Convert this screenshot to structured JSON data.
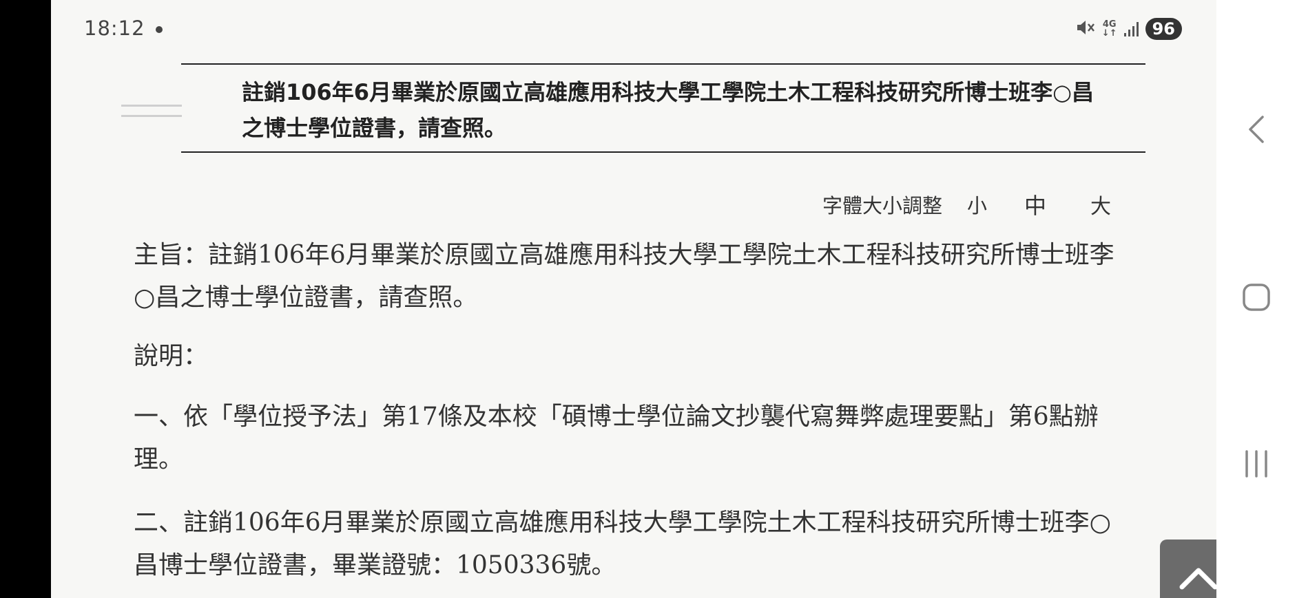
{
  "status_bar": {
    "time": "18:12",
    "network": "4G",
    "battery": "96",
    "icons": [
      "notification-dot-icon",
      "mute-icon",
      "network-4g-icon",
      "signal-icon",
      "battery-icon"
    ]
  },
  "document": {
    "title": "註銷106年6月畢業於原國立高雄應用科技大學工學院土木工程科技研究所博士班李○昌之博士學位證書，請查照。",
    "font_size_control": {
      "label": "字體大小調整",
      "small": "小",
      "medium": "中",
      "large": "大"
    },
    "subject": "主旨：註銷106年6月畢業於原國立高雄應用科技大學工學院土木工程科技研究所博士班李○昌之博士學位證書，請查照。",
    "description_label": "說明：",
    "items": [
      "一、依「學位授予法」第17條及本校「碩博士學位論文抄襲代寫舞弊處理要點」第6點辦理。",
      "二、註銷106年6月畢業於原國立高雄應用科技大學工學院土木工程科技研究所博士班李○昌博士學位證書，畢業證號：1050336號。"
    ]
  },
  "back_to_top": {
    "icon": "chevron-up-icon"
  },
  "nav_bar": {
    "icons": [
      "back-icon",
      "home-icon",
      "recents-icon"
    ]
  },
  "colors": {
    "page_background": "#f7f7f5",
    "text": "#333333",
    "back_to_top_button": "#6b6b6b",
    "nav_icon": "#888888"
  }
}
